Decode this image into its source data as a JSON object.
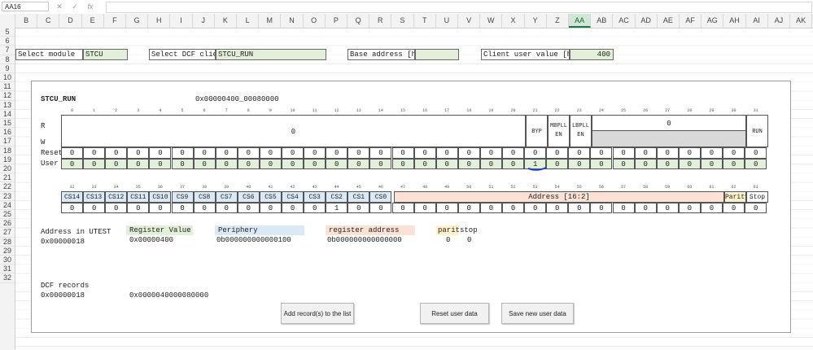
{
  "formula_bar": {
    "name_box": "AA16",
    "cancel_icon": "✕",
    "enter_icon": "✓",
    "fx_label": "fx",
    "formula": ""
  },
  "columns": [
    "B",
    "C",
    "D",
    "E",
    "F",
    "G",
    "H",
    "I",
    "J",
    "K",
    "L",
    "M",
    "N",
    "O",
    "P",
    "Q",
    "R",
    "S",
    "T",
    "U",
    "V",
    "W",
    "X",
    "Y",
    "Z",
    "AA",
    "AB",
    "AC",
    "AD",
    "AE",
    "AF",
    "AG",
    "AH",
    "AI",
    "AJ",
    "AK"
  ],
  "selected_column": "AA",
  "rows": [
    "5",
    "6",
    "7",
    "8",
    "9",
    "10",
    "11",
    "12",
    "13",
    "14",
    "15",
    "16",
    "17",
    "18",
    "19",
    "20",
    "21",
    "22",
    "23",
    "24",
    "25",
    "26",
    "27",
    "28",
    "29",
    "30",
    "31",
    "32"
  ],
  "top_fields": {
    "select_module_label": "Select module",
    "select_module_value": "STCU",
    "select_dcf_label": "Select DCF client",
    "select_dcf_value": "STCU_RUN",
    "base_address_label": "Base address [hex]",
    "base_address_value": "",
    "client_user_label": "Client user value [hex]",
    "client_user_value": "400"
  },
  "register": {
    "name": "STCU_RUN",
    "address": "0x00000400_00080000",
    "upper_bits": [
      "0",
      "1",
      "2",
      "3",
      "4",
      "5",
      "6",
      "7",
      "8",
      "9",
      "10",
      "11",
      "12",
      "13",
      "14",
      "15",
      "16",
      "17",
      "18",
      "19",
      "20",
      "21",
      "22",
      "23",
      "24",
      "25",
      "26",
      "27",
      "28",
      "29",
      "30",
      "31"
    ],
    "r_label": "R",
    "w_label": "W",
    "reset_label": "Reset",
    "user_label": "User",
    "field_zero_left": "0",
    "field_byp": "BYP",
    "field_mbpll": "MBPLL EN",
    "field_lbpll": "LBPLL EN",
    "field_zero_right": "0",
    "field_run": "RUN",
    "reset_row": [
      "0",
      "0",
      "0",
      "0",
      "0",
      "0",
      "0",
      "0",
      "0",
      "0",
      "0",
      "0",
      "0",
      "0",
      "0",
      "0",
      "0",
      "0",
      "0",
      "0",
      "0",
      "0",
      "0",
      "0",
      "0",
      "0",
      "0",
      "0",
      "0",
      "0",
      "0",
      "0"
    ],
    "user_row": [
      "0",
      "0",
      "0",
      "0",
      "0",
      "0",
      "0",
      "0",
      "0",
      "0",
      "0",
      "0",
      "0",
      "0",
      "0",
      "0",
      "0",
      "0",
      "0",
      "0",
      "0",
      "1",
      "0",
      "0",
      "0",
      "0",
      "0",
      "0",
      "0",
      "0",
      "0",
      "0"
    ],
    "lower_bits": [
      "32",
      "33",
      "34",
      "35",
      "36",
      "37",
      "38",
      "39",
      "40",
      "41",
      "42",
      "43",
      "44",
      "45",
      "46",
      "47",
      "48",
      "49",
      "50",
      "51",
      "52",
      "53",
      "54",
      "55",
      "56",
      "57",
      "58",
      "59",
      "60",
      "61",
      "62",
      "63"
    ],
    "cs_fields": [
      "CS14",
      "CS13",
      "CS12",
      "CS11",
      "CS10",
      "CS9",
      "CS8",
      "CS7",
      "CS6",
      "CS5",
      "CS4",
      "CS3",
      "CS2",
      "CS1",
      "CS0"
    ],
    "address_field": "Address [16:2]",
    "parity_field": "Parity",
    "stop_field": "Stop",
    "lower_row": [
      "0",
      "0",
      "0",
      "0",
      "0",
      "0",
      "0",
      "0",
      "0",
      "0",
      "0",
      "0",
      "1",
      "0",
      "0",
      "0",
      "0",
      "0",
      "0",
      "0",
      "0",
      "0",
      "0",
      "0",
      "0",
      "0",
      "0",
      "0",
      "0",
      "0",
      "0",
      "0"
    ]
  },
  "summary": {
    "utest_label": "Address in UTEST",
    "utest_value": "0x00000018",
    "reg_value_label": "Register Value",
    "reg_value": "0x00000400",
    "periphery_label": "Periphery",
    "periphery_value": "0b000000000000100",
    "reg_addr_label": "register address",
    "reg_addr_value": "0b000000000000000",
    "parity_label": "parity",
    "parity_value": "0",
    "stop_label": "stop",
    "stop_value": "0"
  },
  "dcf": {
    "label": "DCF records",
    "utest_value": "0x00000018",
    "record_value": "0x0000040000080000"
  },
  "buttons": {
    "add": "Add record(s) to the list",
    "reset": "Reset user data",
    "save": "Save new user data"
  },
  "colors": {
    "green": "#e2efd9",
    "blue": "#dbe8f6",
    "salmon": "#fbe2d5",
    "yellow": "#fff2cc",
    "gray": "#d9d9d9",
    "selected_header": "#cfe7d5",
    "marker": "#1c3fd1"
  }
}
